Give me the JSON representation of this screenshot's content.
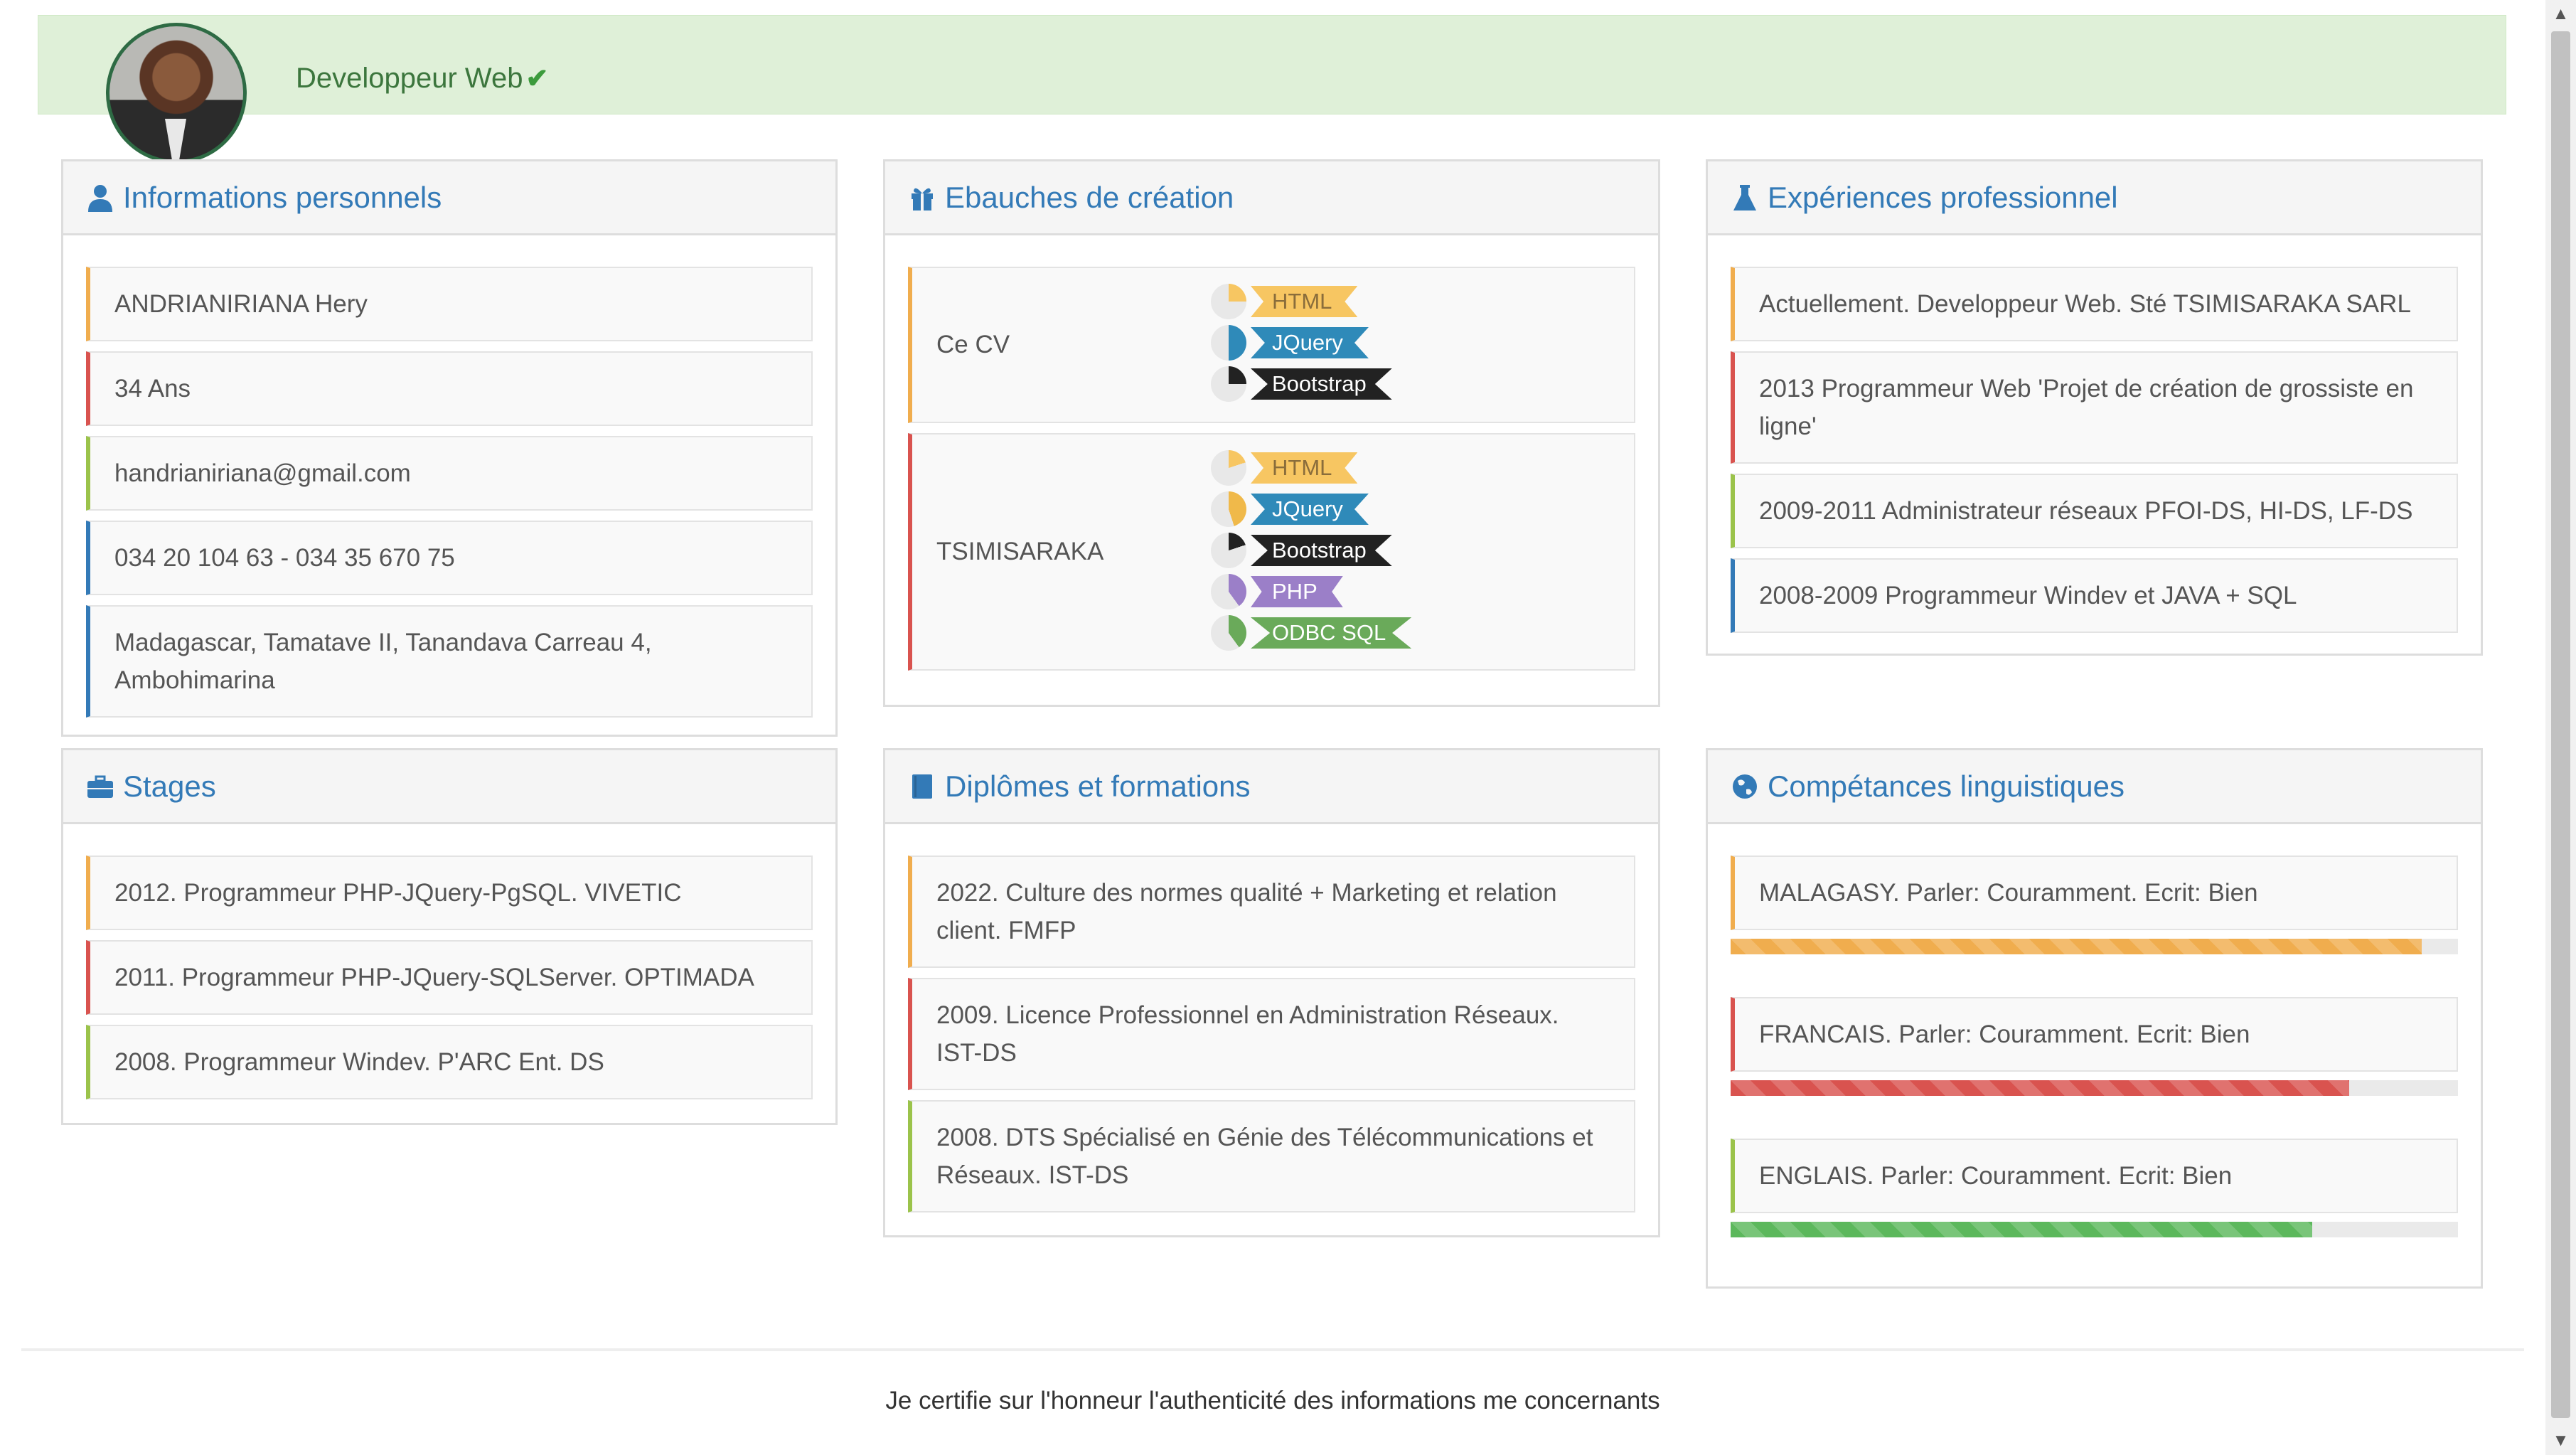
{
  "header": {
    "title": "Developpeur Web",
    "verified_icon": "check-icon",
    "avatar_icon": "profile-photo"
  },
  "personal": {
    "title": "Informations personnels",
    "icon": "user-icon",
    "items": [
      {
        "text": "ANDRIANIRIANA Hery",
        "color": "#f0ad4e"
      },
      {
        "text": "34 Ans",
        "color": "#d9534f"
      },
      {
        "text": "handrianiriana@gmail.com",
        "color": "#9bc34b"
      },
      {
        "text": "034 20 104 63 - 034 35 670 75",
        "color": "#337ab7"
      },
      {
        "text": "Madagascar, Tamatave II, Tanandava Carreau 4, Ambohimarina",
        "color": "#337ab7"
      }
    ]
  },
  "ebauches": {
    "title": "Ebauches de création",
    "icon": "gift-icon",
    "projects": [
      {
        "name": "Ce CV",
        "color": "#f0ad4e",
        "techs": [
          {
            "label": "HTML",
            "color": "#f7c662",
            "text_color": "#8a6d3b",
            "pct": 0.25
          },
          {
            "label": "JQuery",
            "color": "#2f8ab9",
            "text_color": "#ffffff",
            "pct": 0.5
          },
          {
            "label": "Bootstrap",
            "color": "#222222",
            "text_color": "#ffffff",
            "pct": 0.25
          }
        ]
      },
      {
        "name": "TSIMISARAKA",
        "color": "#d9534f",
        "techs": [
          {
            "label": "HTML",
            "color": "#f7c662",
            "text_color": "#8a6d3b",
            "pct": 0.2
          },
          {
            "label": "JQuery",
            "color": "#2f8ab9",
            "text_color": "#ffffff",
            "pct": 0.45
          },
          {
            "label": "Bootstrap",
            "color": "#222222",
            "text_color": "#ffffff",
            "pct": 0.2
          },
          {
            "label": "PHP",
            "color": "#9b7fc8",
            "text_color": "#ffffff",
            "pct": 0.4
          },
          {
            "label": "ODBC SQL",
            "color": "#6aaa5a",
            "text_color": "#ffffff",
            "pct": 0.4
          }
        ]
      }
    ]
  },
  "experiences": {
    "title": "Expériences professionnel",
    "icon": "flask-icon",
    "items": [
      {
        "text": "Actuellement. Developpeur Web. Sté TSIMISARAKA SARL",
        "color": "#f0ad4e"
      },
      {
        "text": "2013 Programmeur Web 'Projet de création de grossiste en ligne'",
        "color": "#d9534f"
      },
      {
        "text": "2009-2011 Administrateur réseaux PFOI-DS, HI-DS, LF-DS",
        "color": "#9bc34b"
      },
      {
        "text": "2008-2009 Programmeur Windev et JAVA + SQL",
        "color": "#337ab7"
      }
    ]
  },
  "stages": {
    "title": "Stages",
    "icon": "briefcase-icon",
    "items": [
      {
        "text": "2012. Programmeur PHP-JQuery-PgSQL. VIVETIC",
        "color": "#f0ad4e"
      },
      {
        "text": "2011. Programmeur PHP-JQuery-SQLServer. OPTIMADA",
        "color": "#d9534f"
      },
      {
        "text": "2008. Programmeur Windev. P'ARC Ent. DS",
        "color": "#9bc34b"
      }
    ]
  },
  "diplomes": {
    "title": "Diplômes et formations",
    "icon": "book-icon",
    "items": [
      {
        "text": "2022. Culture des normes qualité + Marketing et relation client. FMFP",
        "color": "#f0ad4e"
      },
      {
        "text": "2009. Licence Professionnel en Administration Réseaux. IST-DS",
        "color": "#d9534f"
      },
      {
        "text": "2008. DTS Spécialisé en Génie des Télécommunications et Réseaux. IST-DS",
        "color": "#9bc34b"
      }
    ]
  },
  "langues": {
    "title": "Compétances linguistiques",
    "icon": "globe-icon",
    "items": [
      {
        "text": "MALAGASY. Parler: Couramment. Ecrit: Bien",
        "color": "#f0ad4e",
        "level": 0.95
      },
      {
        "text": "FRANCAIS. Parler: Couramment. Ecrit: Bien",
        "color": "#d9534f",
        "level": 0.85
      },
      {
        "text": "ENGLAIS. Parler: Couramment. Ecrit: Bien",
        "color": "#5cb85c",
        "level": 0.8
      }
    ]
  },
  "footer": {
    "text": "Je certifie sur l'honneur l'authenticité des informations me concernants"
  }
}
